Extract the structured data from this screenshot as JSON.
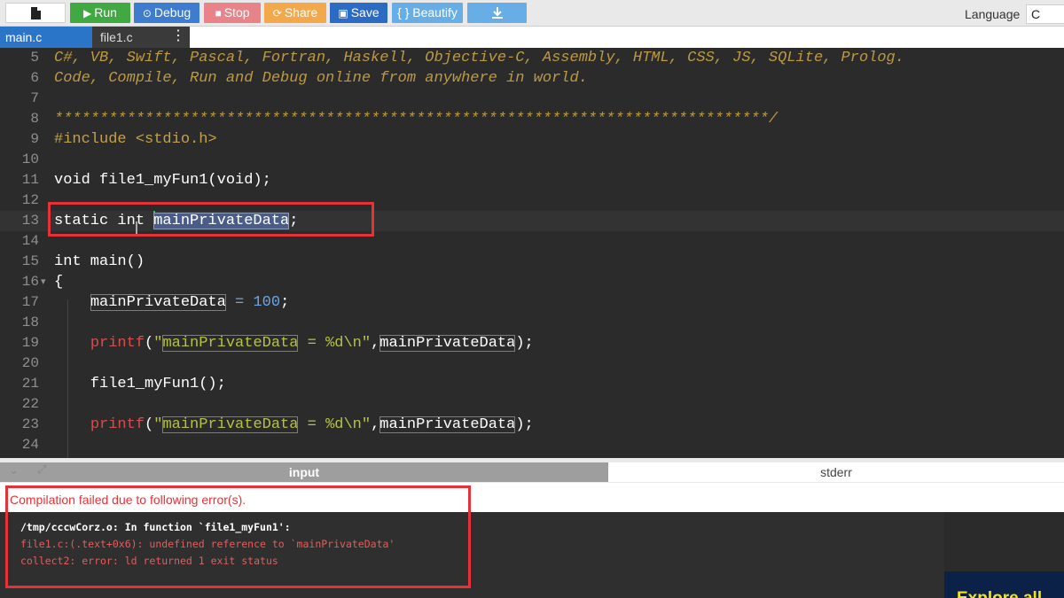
{
  "toolbar": {
    "file_icon": "file-icon",
    "run": "Run",
    "debug": "Debug",
    "stop": "Stop",
    "share": "Share",
    "save": "Save",
    "beautify": "{ } Beautify",
    "download_icon": "download-icon",
    "language_label": "Language",
    "language_value": "C"
  },
  "tabs": {
    "main": "main.c",
    "file1": "file1.c",
    "menu": "⋮"
  },
  "editor": {
    "lines": [
      {
        "n": "5",
        "text": "C#, VB, Swift, Pascal, Fortran, Haskell, Objective-C, Assembly, HTML, CSS, JS, SQLite, Prolog."
      },
      {
        "n": "6",
        "text": "Code, Compile, Run and Debug online from anywhere in world."
      },
      {
        "n": "7",
        "text": ""
      },
      {
        "n": "8",
        "text": "*******************************************************************************/"
      },
      {
        "n": "9",
        "text": "#include <stdio.h>"
      },
      {
        "n": "10",
        "text": ""
      },
      {
        "n": "11",
        "text": "void file1_myFun1(void);"
      },
      {
        "n": "12",
        "text": ""
      },
      {
        "n": "13",
        "text": "static int mainPrivateData;"
      },
      {
        "n": "14",
        "text": ""
      },
      {
        "n": "15",
        "text": "int main()"
      },
      {
        "n": "16",
        "text": "{"
      },
      {
        "n": "17",
        "text": "    mainPrivateData = 100;"
      },
      {
        "n": "18",
        "text": ""
      },
      {
        "n": "19",
        "text": "    printf(\"mainPrivateData = %d\\n\",mainPrivateData);"
      },
      {
        "n": "20",
        "text": ""
      },
      {
        "n": "21",
        "text": "    file1_myFun1();"
      },
      {
        "n": "22",
        "text": ""
      },
      {
        "n": "23",
        "text": "    printf(\"mainPrivateData = %d\\n\",mainPrivateData);"
      },
      {
        "n": "24",
        "text": ""
      }
    ]
  },
  "output": {
    "input_tab": "input",
    "stderr_tab": "stderr",
    "error_banner": "Compilation failed due to following error(s).",
    "terminal": [
      "/tmp/cccwCorz.o: In function `file1_myFun1':",
      "file1.c:(.text+0x6): undefined reference to `mainPrivateData'",
      "collect2: error: ld returned 1 exit status"
    ]
  },
  "promo": {
    "text": "Explore all"
  },
  "colors": {
    "run": "#40a941",
    "debug": "#3e7ccf",
    "stop": "#e8838a",
    "share": "#f3a84b",
    "save": "#2c6bc4",
    "beautify": "#68aee6",
    "annotation": "#e53238"
  }
}
